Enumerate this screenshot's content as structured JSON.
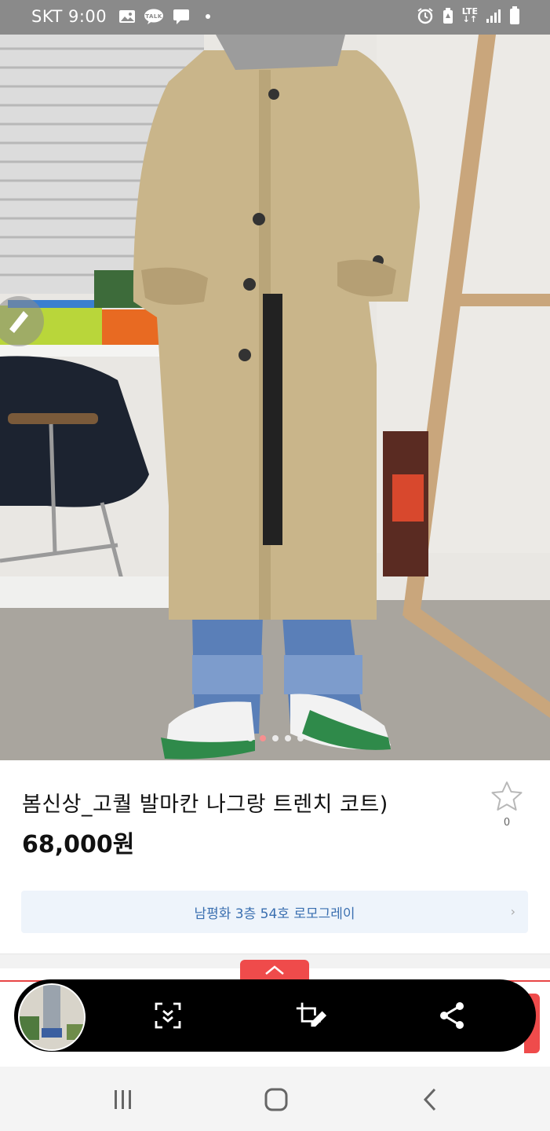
{
  "status_bar": {
    "carrier": "SKT",
    "time": "9:00",
    "network": "LTE"
  },
  "product": {
    "title": "봄신상_고퀄 발마칸 나그랑 트렌치 코트)",
    "price": "68,000원",
    "favorite_count": "0",
    "store_link": "남평화 3층 54호 로모그레이",
    "image_page_count": 5,
    "image_active_index": 2
  },
  "capture_toolbar": {
    "tools": [
      "scroll-capture-icon",
      "crop-edit-icon",
      "share-icon"
    ]
  },
  "nav_bar": {
    "buttons": [
      "recent-apps",
      "home",
      "back"
    ]
  },
  "colors": {
    "accent_red": "#ef4b4b",
    "link_blue": "#3a6fb0",
    "status_bar_bg": "#8a8a8a"
  }
}
